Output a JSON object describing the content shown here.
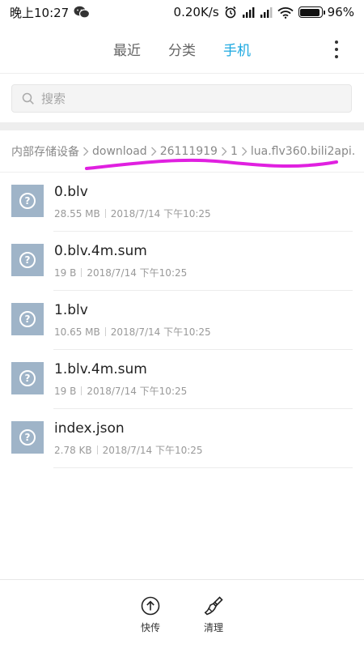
{
  "status_bar": {
    "time": "晚上10:27",
    "speed": "0.20K/s",
    "battery": "96%",
    "battery_level": 0.96
  },
  "tabs": [
    {
      "label": "最近",
      "active": false
    },
    {
      "label": "分类",
      "active": false
    },
    {
      "label": "手机",
      "active": true
    }
  ],
  "search": {
    "placeholder": "搜索"
  },
  "breadcrumb": [
    "内部存储设备",
    "download",
    "26111919",
    "1",
    "lua.flv360.bili2api."
  ],
  "files": [
    {
      "name": "0.blv",
      "size": "28.55 MB",
      "date": "2018/7/14 下午10:25"
    },
    {
      "name": "0.blv.4m.sum",
      "size": "19 B",
      "date": "2018/7/14 下午10:25"
    },
    {
      "name": "1.blv",
      "size": "10.65 MB",
      "date": "2018/7/14 下午10:25"
    },
    {
      "name": "1.blv.4m.sum",
      "size": "19 B",
      "date": "2018/7/14 下午10:25"
    },
    {
      "name": "index.json",
      "size": "2.78 KB",
      "date": "2018/7/14 下午10:25"
    }
  ],
  "bottom_bar": {
    "share_label": "快传",
    "clean_label": "清理"
  },
  "colors": {
    "accent": "#1ba8e0",
    "file_icon": "#9fb4c8",
    "annotation": "#e020e0"
  }
}
